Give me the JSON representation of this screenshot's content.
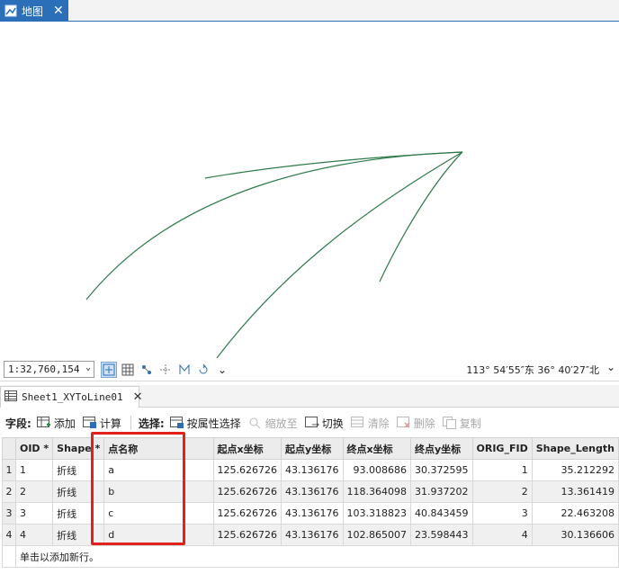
{
  "map_tab": {
    "label": "地图",
    "icon": "map-icon",
    "close_icon": "close-icon"
  },
  "status": {
    "scale": "1:32,760,154",
    "coordinates": "113° 54′55″东 36° 40′27″北"
  },
  "table_tab": {
    "label": "Sheet1_XYToLine01",
    "icon": "table-icon"
  },
  "toolbar": {
    "field_label": "字段:",
    "add": "添加",
    "calculate": "计算",
    "selection_label": "选择:",
    "select_by_attr": "按属性选择",
    "zoom_to": "缩放至",
    "switch": "切换",
    "clear": "清除",
    "delete": "删除",
    "copy": "复制"
  },
  "grid": {
    "columns": [
      "OID *",
      "Shape *",
      "点名称",
      "起点x坐标",
      "起点y坐标",
      "终点x坐标",
      "终点y坐标",
      "ORIG_FID",
      "Shape_Length"
    ],
    "rows": [
      {
        "rownum": "1",
        "oid": "1",
        "shape": "折线",
        "name": "a",
        "sx": "125.626726",
        "sy": "43.136176",
        "ex": "93.008686",
        "ey": "30.372595",
        "fid": "1",
        "len": "35.212292"
      },
      {
        "rownum": "2",
        "oid": "2",
        "shape": "折线",
        "name": "b",
        "sx": "125.626726",
        "sy": "43.136176",
        "ex": "118.364098",
        "ey": "31.937202",
        "fid": "2",
        "len": "13.361419"
      },
      {
        "rownum": "3",
        "oid": "3",
        "shape": "折线",
        "name": "c",
        "sx": "125.626726",
        "sy": "43.136176",
        "ex": "103.318823",
        "ey": "40.843459",
        "fid": "3",
        "len": "22.463208"
      },
      {
        "rownum": "4",
        "oid": "4",
        "shape": "折线",
        "name": "d",
        "sx": "125.626726",
        "sy": "43.136176",
        "ex": "102.865007",
        "ey": "23.598443",
        "fid": "4",
        "len": "30.136606"
      }
    ],
    "new_row_hint": "单击以添加新行。"
  },
  "colors": {
    "accent": "#2a6fb7",
    "line": "#2f7a4a",
    "highlight": "#e2211c"
  }
}
